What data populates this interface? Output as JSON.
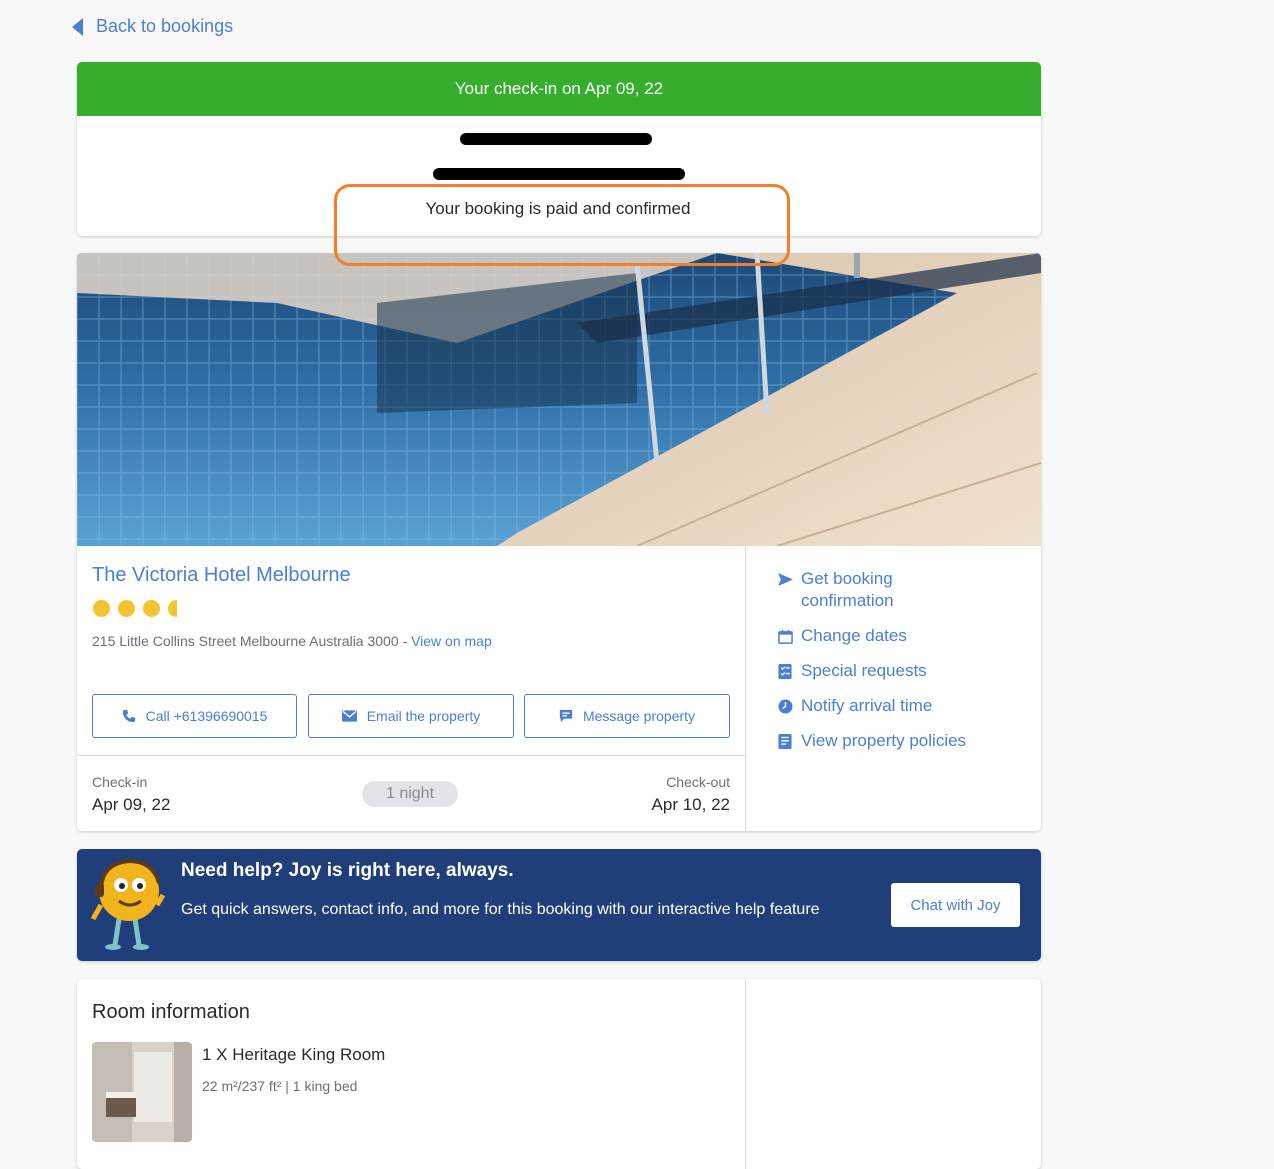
{
  "nav": {
    "back_label": "Back to bookings"
  },
  "status": {
    "banner_text": "Your check-in on Apr 09, 22",
    "confirmation_text": "Your booking is paid and confirmed",
    "banner_color": "#34ae2c",
    "highlight_color": "#f47f2a"
  },
  "hotel": {
    "name": "The Victoria Hotel Melbourne",
    "star_rating": 3.5,
    "address": "215 Little Collins Street Melbourne Australia 3000 - ",
    "map_link": "View on map",
    "buttons": {
      "call": "Call +61396690015",
      "email": "Email the property",
      "message": "Message property"
    },
    "checkin_label": "Check-in",
    "checkin_date": "Apr 09, 22",
    "nights": "1 night",
    "checkout_label": "Check-out",
    "checkout_date": "Apr 10, 22"
  },
  "actions": {
    "get_confirmation": "Get booking confirmation",
    "change_dates": "Change dates",
    "special_requests": "Special requests",
    "notify_arrival": "Notify arrival time",
    "view_policies": "View property policies"
  },
  "help": {
    "title": "Need help? Joy is right here, always.",
    "description": "Get quick answers, contact info, and more for this booking with our interactive help feature",
    "button": "Chat with Joy"
  },
  "room": {
    "section_title": "Room information",
    "name": "1 X Heritage King Room",
    "meta": "22 m²/237 ft² | 1 king bed"
  },
  "colors": {
    "accent": "#4a7fd4",
    "help_bg": "#203f7a",
    "star": "#f4c430"
  }
}
